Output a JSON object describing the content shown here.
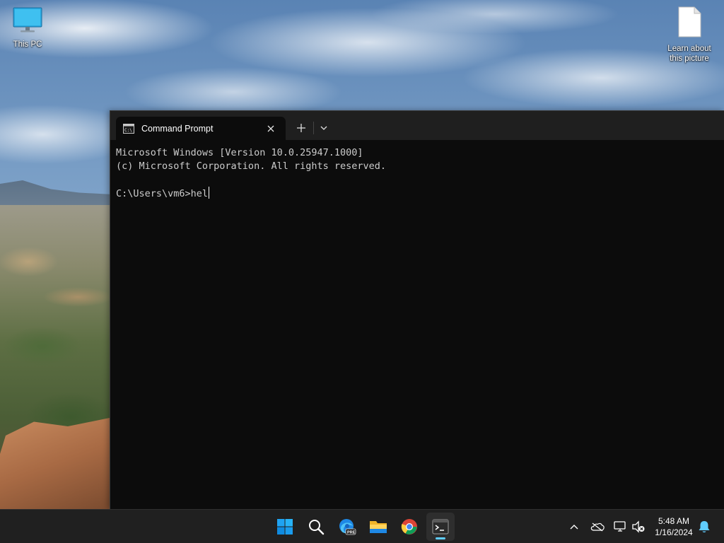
{
  "desktop": {
    "icons": [
      {
        "label": "This PC",
        "icon": "monitor-icon"
      },
      {
        "label": "Learn about this picture",
        "icon": "document-icon"
      }
    ]
  },
  "terminal": {
    "tab": {
      "title": "Command Prompt",
      "icon": "cmd-icon"
    },
    "new_tab": "+",
    "lines": [
      "Microsoft Windows [Version 10.0.25947.1000]",
      "(c) Microsoft Corporation. All rights reserved.",
      "",
      "C:\\Users\\vm6>hel"
    ],
    "colors": {
      "background": "#0c0c0c",
      "tabbar": "#1f1f1f",
      "text": "#cccccc"
    }
  },
  "taskbar": {
    "apps": [
      {
        "name": "Start",
        "icon": "windows-start-icon"
      },
      {
        "name": "Search",
        "icon": "search-icon"
      },
      {
        "name": "Microsoft Edge Preview",
        "icon": "edge-preview-icon",
        "badge": "PRE"
      },
      {
        "name": "File Explorer",
        "icon": "folder-icon"
      },
      {
        "name": "Google Chrome",
        "icon": "chrome-icon"
      },
      {
        "name": "Terminal",
        "icon": "terminal-icon",
        "active": true
      }
    ],
    "tray": [
      "chevron-up-icon",
      "onedrive-icon",
      "network-icon",
      "volume-muted-icon"
    ],
    "clock": {
      "time": "5:48 AM",
      "date": "1/16/2024"
    },
    "notification_icon": "bell-icon",
    "accent": "#60cdff"
  }
}
